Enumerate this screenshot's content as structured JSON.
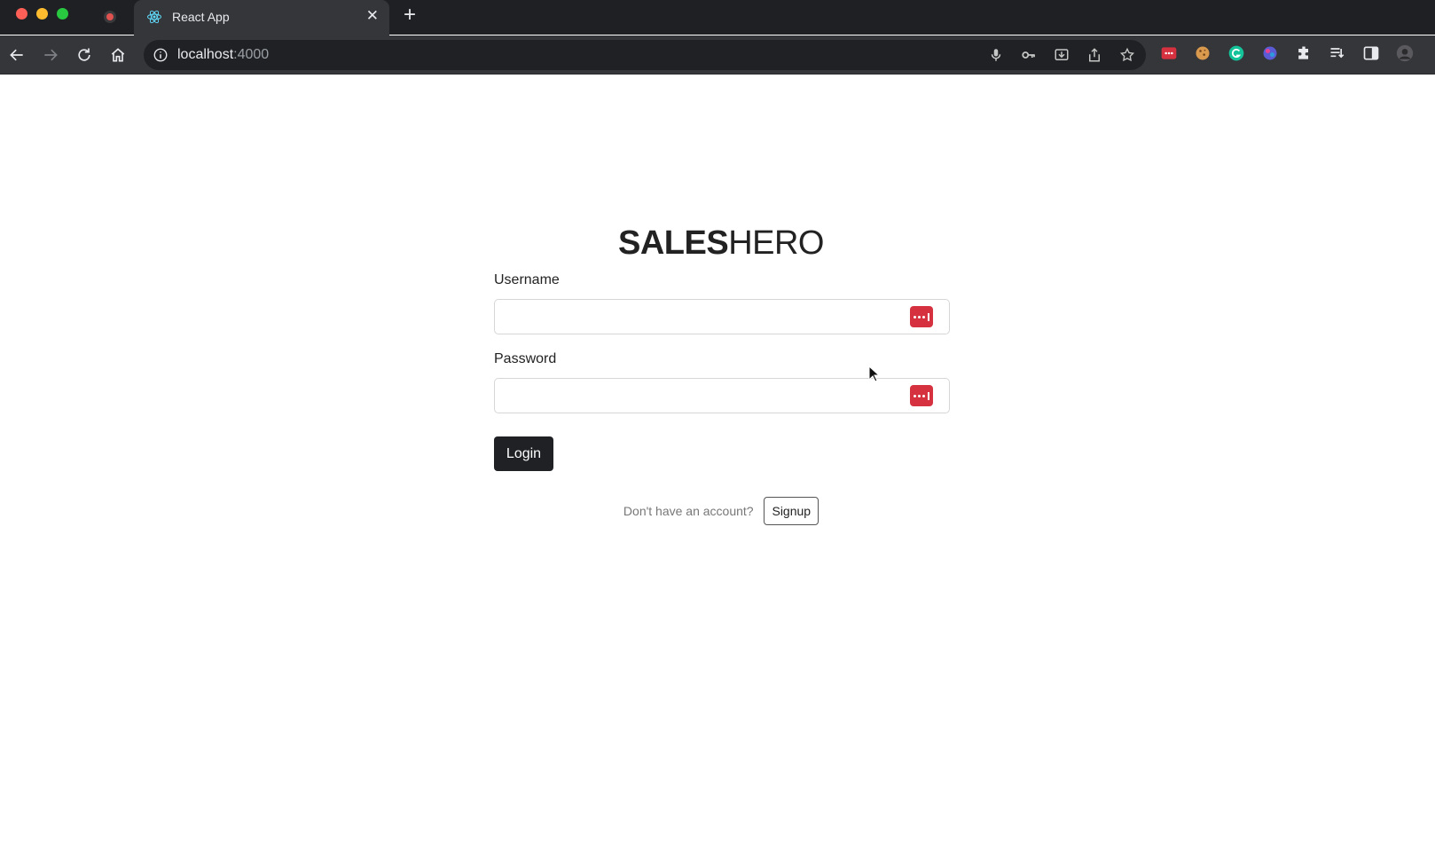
{
  "browser": {
    "tab_title": "React App",
    "tab_close_glyph": "✕",
    "new_tab_glyph": "+",
    "url_host": "localhost",
    "url_port": ":4000",
    "icons": {
      "tab_favicon": "react-icon",
      "recording": "record-icon",
      "nav": [
        "back-arrow-icon",
        "forward-arrow-icon",
        "reload-icon",
        "home-icon"
      ],
      "omnibox": [
        "microphone-icon",
        "key-icon",
        "install-icon",
        "share-icon",
        "bookmark-star-icon"
      ],
      "extensions": [
        "lastpass-extension-icon",
        "cookie-extension-icon",
        "grammarly-extension-icon",
        "color-extension-icon",
        "puzzle-extensions-icon",
        "reading-list-icon",
        "side-panel-icon",
        "profile-avatar-icon"
      ]
    },
    "colors": {
      "chrome_dark": "#1f2023",
      "tab_active": "#35363a",
      "omnibox": "#202124"
    }
  },
  "page": {
    "logo_bold": "SALES",
    "logo_regular": "HERO",
    "username_label": "Username",
    "username_value": "",
    "password_label": "Password",
    "password_value": "",
    "login_button": "Login",
    "signup_prompt": "Don't have an account?",
    "signup_button": "Signup",
    "colors": {
      "password_manager_icon": "#d6313f",
      "login_button_bg": "#1f2124"
    }
  }
}
